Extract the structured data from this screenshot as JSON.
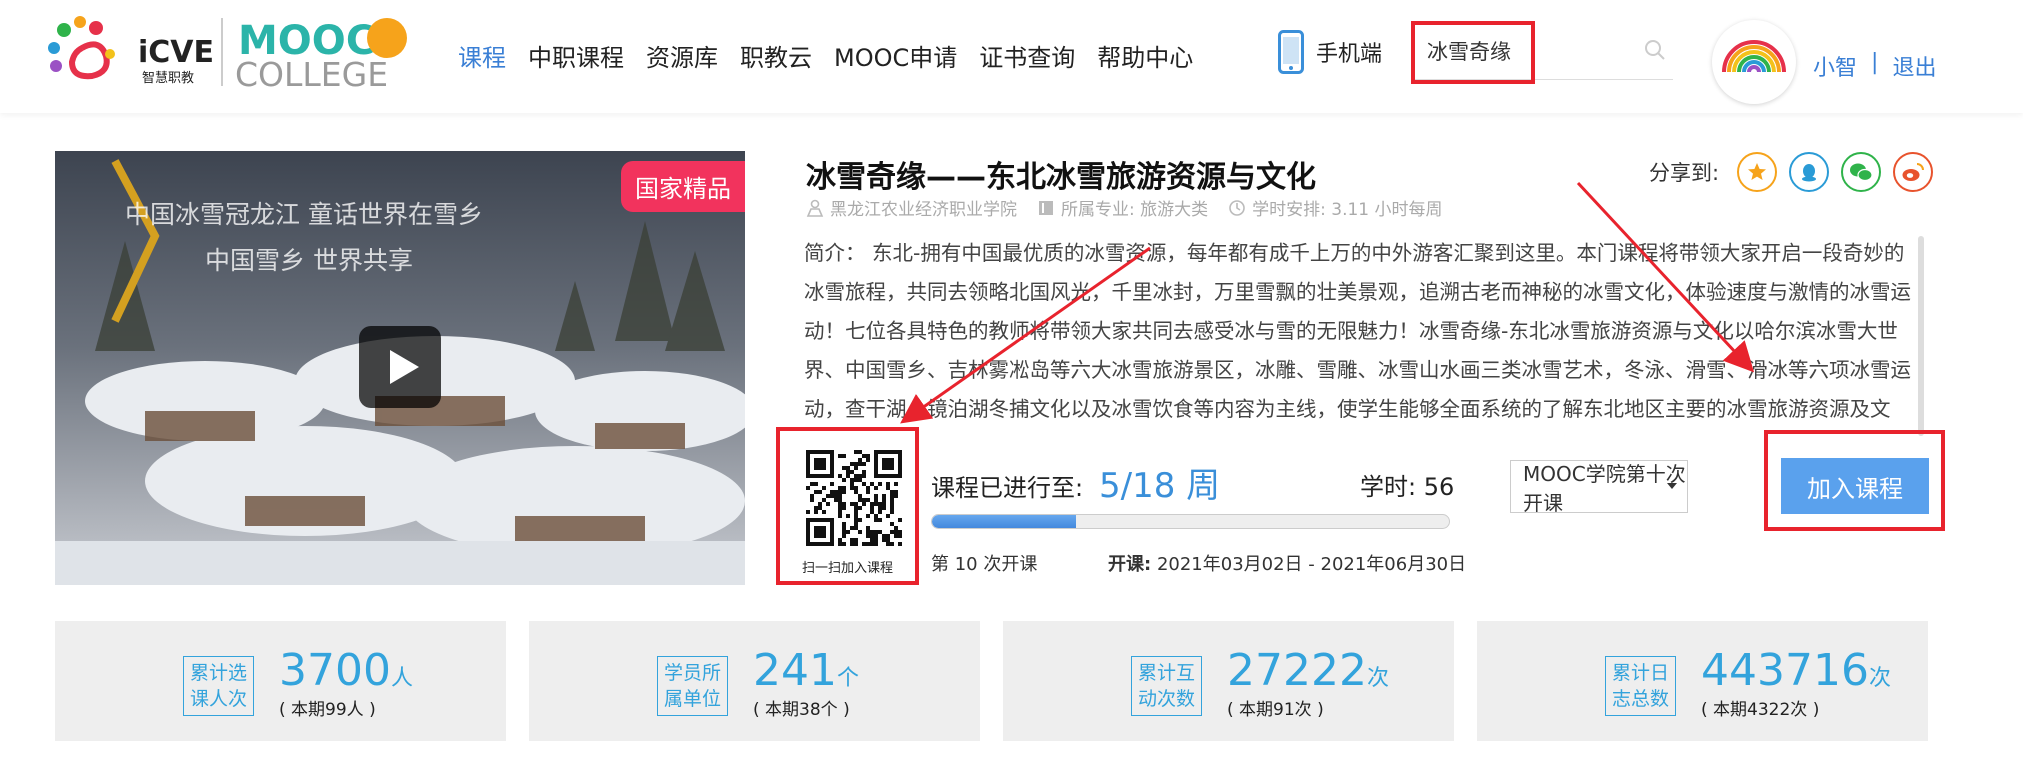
{
  "header": {
    "logo_icve": "iCVE",
    "logo_icve_sub": "智慧职教",
    "logo_mooc": "MOOC",
    "logo_college": "COLLEGE",
    "nav": [
      "课程",
      "中职课程",
      "资源库",
      "职教云",
      "MOOC申请",
      "证书查询",
      "帮助中心"
    ],
    "active_nav": "课程",
    "mobile_label": "手机端",
    "search_value": "冰雪奇缘",
    "user_name": "小智",
    "separator": "|",
    "logout": "退出"
  },
  "course": {
    "badge": "国家精品",
    "cover_text_line1": "中国冰雪冠龙江 童话世界在雪乡",
    "cover_text_line2": "中国雪乡 世界共享",
    "title": "冰雪奇缘——东北冰雪旅游资源与文化",
    "school": "黑龙江农业经济职业学院",
    "major": "所属专业: 旅游大类",
    "schedule": "学时安排: 3.11 小时每周",
    "share_label": "分享到:",
    "intro": "简介：  东北-拥有中国最优质的冰雪资源，每年都有成千上万的中外游客汇聚到这里。本门课程将带领大家开启一段奇妙的冰雪旅程，共同去领略北国风光，千里冰封，万里雪飘的壮美景观，追溯古老而神秘的冰雪文化，体验速度与激情的冰雪运动！七位各具特色的教师将带领大家共同去感受冰与雪的无限魅力！冰雪奇缘-东北冰雪旅游资源与文化以哈尔滨冰雪大世界、中国雪乡、吉林雾凇岛等六大冰雪旅游景区，冰雕、雪雕、冰雪山水画三类冰雪艺术，冬泳、滑雪、滑冰等六项冰雪运动，查干湖、镜泊湖冬捕文化以及冰雪饮食等内容为主线，使学生能够全面系统的了解东北地区主要的冰雪旅游资源及文化。",
    "qr_caption": "扫一扫加入课程",
    "progress_label": "课程已进行至:",
    "progress_value": "5/18 周",
    "progress_fraction": 0.278,
    "hours": "学时: 56",
    "session_no": "第 10 次开课",
    "dates_label": "开课:",
    "dates_value": "2021年03月02日 - 2021年06月30日",
    "session_select": "MOOC学院第十次开课",
    "join_button": "加入课程"
  },
  "stats": [
    {
      "label": "累计选课人次",
      "value": "3700",
      "unit": "人",
      "sub": "( 本期99人 )"
    },
    {
      "label": "学员所属单位",
      "value": "241",
      "unit": "个",
      "sub": "( 本期38个 )"
    },
    {
      "label": "累计互动次数",
      "value": "27222",
      "unit": "次",
      "sub": "( 本期91次 )"
    },
    {
      "label": "累计日志总数",
      "value": "443716",
      "unit": "次",
      "sub": "( 本期4322次 )"
    }
  ],
  "colors": {
    "accent": "#3a7fd5",
    "stat_blue": "#33a3dc",
    "highlight_red": "#e8232d",
    "badge_pink": "#f2335d",
    "join_blue": "#5aa1ed"
  },
  "icons": [
    "phone-icon",
    "search-icon",
    "school-icon",
    "book-icon",
    "clock-icon",
    "star-share-icon",
    "qq-share-icon",
    "wechat-share-icon",
    "weibo-share-icon",
    "play-icon",
    "qr-code"
  ]
}
